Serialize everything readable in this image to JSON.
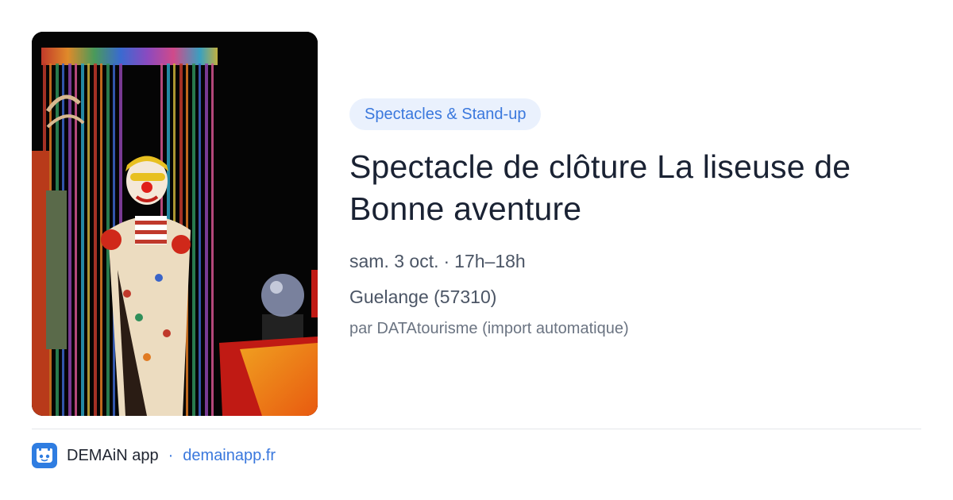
{
  "event": {
    "category": "Spectacles & Stand-up",
    "title": "Spectacle de clôture La liseuse de Bonne aventure",
    "date": "sam. 3 oct.",
    "separator": "·",
    "time": "17h–18h",
    "location": "Guelange (57310)",
    "source": "par DATAtourisme (import automatique)"
  },
  "footer": {
    "app_name": "DEMAiN app",
    "separator": "·",
    "site": "demainapp.fr"
  },
  "colors": {
    "accent": "#3a78dd",
    "tag_background": "#eaf1fd",
    "app_logo": "#2f7de1"
  },
  "icons": {
    "app_logo": "demain-app-logo-icon"
  }
}
